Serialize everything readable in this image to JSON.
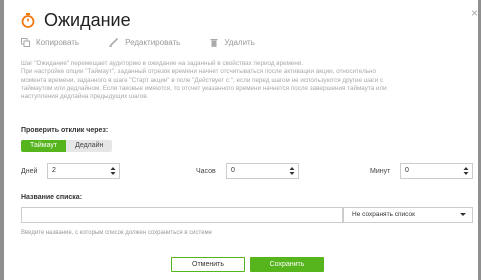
{
  "dialog": {
    "title": "Ожидание",
    "close_glyph": "×",
    "accent_color": "#56b41d",
    "title_icon": "stopwatch-icon"
  },
  "toolbar": {
    "copy_label": "Копировать",
    "edit_label": "Редактировать",
    "delete_label": "Удалить",
    "icons": [
      "copy-icon",
      "pencil-icon",
      "trash-icon"
    ]
  },
  "description": {
    "line1": "Шаг \"Ожидание\" перемещает аудиторию в ожидание на заданный в свойствах период времени.",
    "line2": "При настройке опции \"Таймаут\", заданный отрезок времени начнет отсчитываться после активации акции, относительно",
    "line3": "момента времени, заданного в шаге \"Старт акции\" в поле \"Действует с:\", если перед шагом не используются другие шаги с",
    "line4": "таймаутом или дедлайном. Если таковые имеются, то отсчет указанного времени начнется после завершения таймаута или",
    "line5": "наступления дедлайна предыдущих шагов."
  },
  "response_check": {
    "label": "Проверить отклик через:",
    "options": [
      "Таймаут",
      "Дедлайн"
    ],
    "selected": "Таймаут"
  },
  "duration": {
    "days_label": "Дней",
    "days_value": "2",
    "hours_label": "Часов",
    "hours_value": "0",
    "minutes_label": "Минут",
    "minutes_value": "0"
  },
  "list": {
    "label": "Название списка:",
    "name_value": "",
    "save_option": "Не сохранять список",
    "hint": "Введите название, с которым список должен сохраниться в системе"
  },
  "footer": {
    "cancel_label": "Отменить",
    "save_label": "Сохранить"
  }
}
